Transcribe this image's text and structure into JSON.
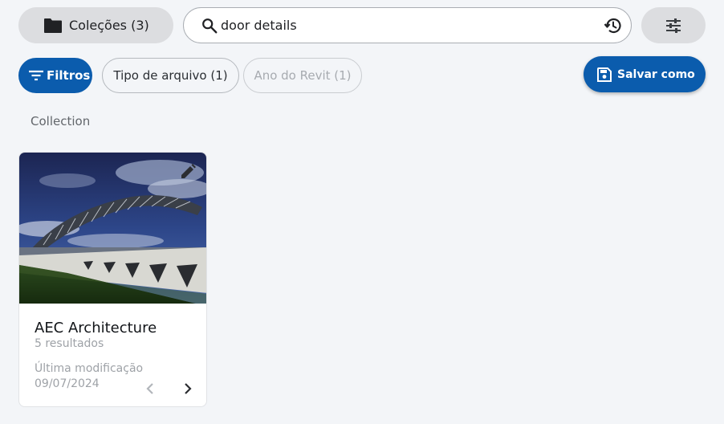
{
  "header": {
    "collections_label": "Coleções (3)",
    "collections_icon": "folder-icon",
    "search": {
      "value": "door details",
      "icon": "search-icon",
      "history_icon": "history-icon"
    },
    "settings_icon": "sliders-icon"
  },
  "filter_bar": {
    "filters_label": "Filtros",
    "filters_icon": "filter-icon",
    "chips": [
      {
        "label": "Tipo de arquivo (1)",
        "enabled": true
      },
      {
        "label": "Ano do Revit (1)",
        "enabled": false
      }
    ],
    "save_as_label": "Salvar como",
    "save_icon": "save-icon"
  },
  "section": {
    "label": "Collection"
  },
  "cards": [
    {
      "title": "AEC Architecture",
      "results": "5 resultados",
      "modified_label": "Última modificação",
      "modified_date": "09/07/2024",
      "edit_icon": "pencil-icon",
      "prev_icon": "chevron-left-icon",
      "next_icon": "chevron-right-icon"
    }
  ],
  "colors": {
    "primary": "#0b5cad",
    "background": "#f3f5f8",
    "secondary_button": "#dcdde0"
  }
}
